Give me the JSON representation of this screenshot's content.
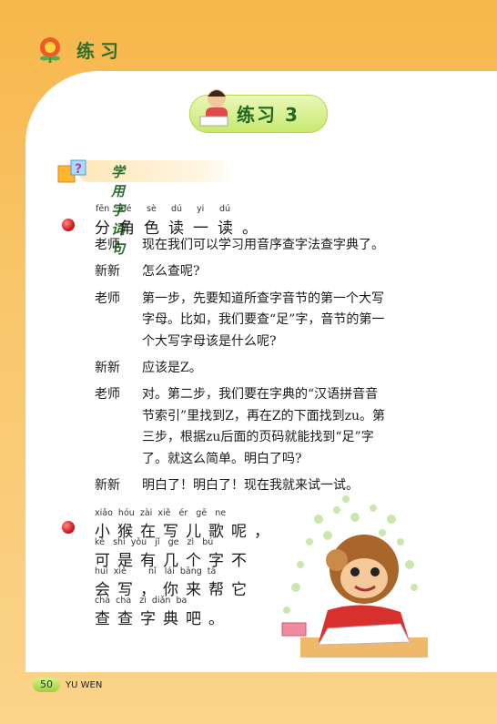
{
  "header": {
    "title": "练习"
  },
  "banner": {
    "title": "练习 3"
  },
  "section": {
    "title": "学用字词句"
  },
  "activity1": {
    "pinyin": [
      "fēn",
      "jué",
      "sè",
      "dú",
      "yi",
      "dú"
    ],
    "hanzi": [
      "分",
      "角",
      "色",
      "读",
      "一",
      "读",
      "。"
    ],
    "dialog": [
      {
        "speaker": "老师",
        "lines": [
          "现在我们可以学习用音序查字法查字典了。"
        ]
      },
      {
        "speaker": "新新",
        "lines": [
          "怎么查呢?"
        ]
      },
      {
        "speaker": "老师",
        "lines": [
          "第一步，先要知道所查字音节的第一个大写",
          "字母。比如，我们要查“足”字，音节的第一",
          "个大写字母该是什么呢?"
        ]
      },
      {
        "speaker": "新新",
        "lines": [
          "应该是Z。"
        ]
      },
      {
        "speaker": "老师",
        "lines": [
          "对。第二步，我们要在字典的“汉语拼音音",
          "节索引”里找到Z，再在Z的下面找到zu。第",
          "三步，根据zu后面的页码就能找到“足”字",
          "了。就这么简单。明白了吗?"
        ]
      },
      {
        "speaker": "新新",
        "lines": [
          "明白了！明白了！现在我就来试一试。"
        ]
      }
    ]
  },
  "poem": {
    "rows": [
      {
        "pinyin": "xiǎo  hóu  zài  xiě   ér   gē   ne",
        "hanzi": "小猴在写儿歌呢，"
      },
      {
        "pinyin": "kě   shì  yǒu   jǐ   ge   zì   bú",
        "hanzi": "可是有几个字不"
      },
      {
        "pinyin": "huì  xiě        nǐ   lái  bāng  tā",
        "hanzi": "会写，你来帮它"
      },
      {
        "pinyin": "chá  cha   zì  diǎn  ba",
        "hanzi": "查查字典吧。"
      }
    ]
  },
  "footer": {
    "page_number": "50",
    "label": "YU WEN"
  }
}
